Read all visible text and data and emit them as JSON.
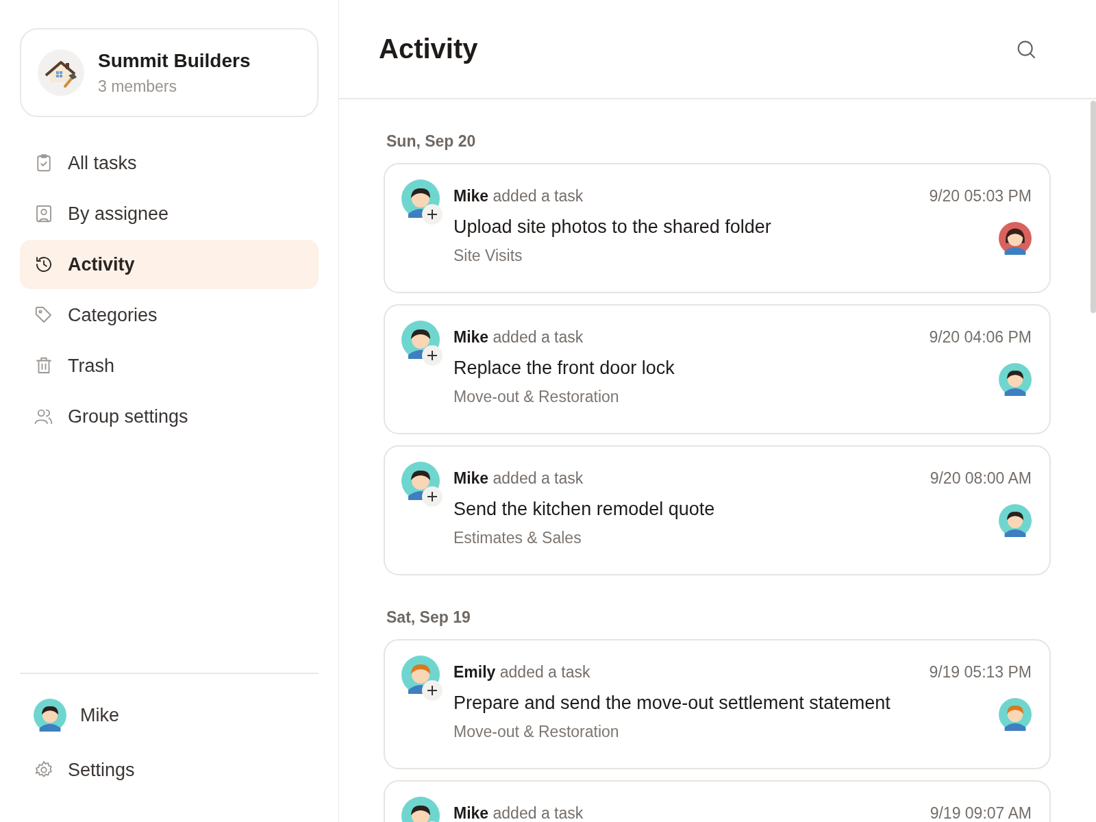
{
  "sidebar": {
    "group": {
      "name": "Summit Builders",
      "members": "3 members"
    },
    "nav": [
      {
        "label": "All tasks",
        "kind": "clipboard",
        "selected": false
      },
      {
        "label": "By assignee",
        "kind": "person",
        "selected": false
      },
      {
        "label": "Activity",
        "kind": "history",
        "selected": true
      },
      {
        "label": "Categories",
        "kind": "tag",
        "selected": false
      },
      {
        "label": "Trash",
        "kind": "trash",
        "selected": false
      },
      {
        "label": "Group settings",
        "kind": "people",
        "selected": false
      }
    ],
    "user": {
      "name": "Mike",
      "avatar": {
        "kind": "dark-hair",
        "color": "#6fd6cf"
      }
    },
    "settings": "Settings"
  },
  "main": {
    "title": "Activity",
    "days": [
      {
        "date": "Sun, Sep 20",
        "entries": [
          {
            "actor": "Mike",
            "avatar": {
              "kind": "dark-hair",
              "color": "#6fd6cf"
            },
            "action": "added a task",
            "time": "9/20 05:03 PM",
            "task": "Upload site photos to the shared folder",
            "category": "Site Visits",
            "assignee": {
              "kind": "long-hair",
              "color": "#d9625f"
            }
          },
          {
            "actor": "Mike",
            "avatar": {
              "kind": "dark-hair",
              "color": "#6fd6cf"
            },
            "action": "added a task",
            "time": "9/20 04:06 PM",
            "task": "Replace the front door lock",
            "category": "Move-out & Restoration",
            "assignee": {
              "kind": "dark-hair",
              "color": "#6fd6cf"
            }
          },
          {
            "actor": "Mike",
            "avatar": {
              "kind": "dark-hair",
              "color": "#6fd6cf"
            },
            "action": "added a task",
            "time": "9/20 08:00 AM",
            "task": "Send the kitchen remodel quote",
            "category": "Estimates & Sales",
            "assignee": {
              "kind": "dark-hair",
              "color": "#6fd6cf"
            }
          }
        ]
      },
      {
        "date": "Sat, Sep 19",
        "entries": [
          {
            "actor": "Emily",
            "avatar": {
              "kind": "orange-hair",
              "color": "#6fd6cf"
            },
            "action": "added a task",
            "time": "9/19 05:13 PM",
            "task": "Prepare and send the move-out settlement statement",
            "category": "Move-out & Restoration",
            "assignee": {
              "kind": "orange-hair",
              "color": "#6fd6cf"
            }
          },
          {
            "actor": "Mike",
            "avatar": {
              "kind": "dark-hair",
              "color": "#6fd6cf"
            },
            "action": "added a task",
            "time": "9/19 09:07 AM"
          }
        ]
      }
    ]
  }
}
